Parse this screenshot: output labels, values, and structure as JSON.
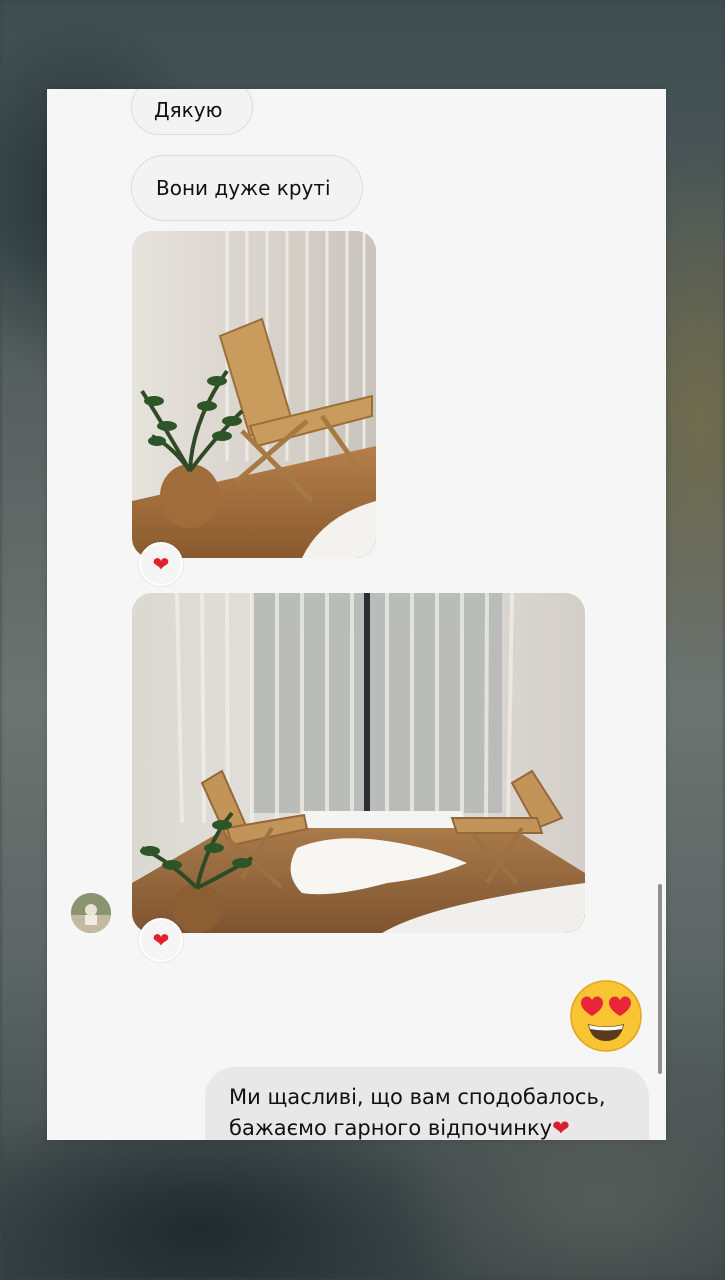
{
  "messages": {
    "incoming_1": "Дякую",
    "incoming_2": "Вони дуже круті",
    "outgoing_line1": "Ми щасливі, що вам сподобалось,",
    "outgoing_line2": "бажаємо гарного відпочинку",
    "outgoing_heart": "❤"
  },
  "reactions": {
    "photo1": "❤",
    "photo2": "❤"
  },
  "icons": {
    "reaction": "heart-icon",
    "sent_emoji": "heart-eyes-emoji-icon",
    "avatar": "avatar"
  },
  "colors": {
    "heart": "#e0202e",
    "bubble_incoming": "#f3f3f3",
    "bubble_outgoing": "#e8e8e8",
    "emoji_face": "#f8c431"
  }
}
